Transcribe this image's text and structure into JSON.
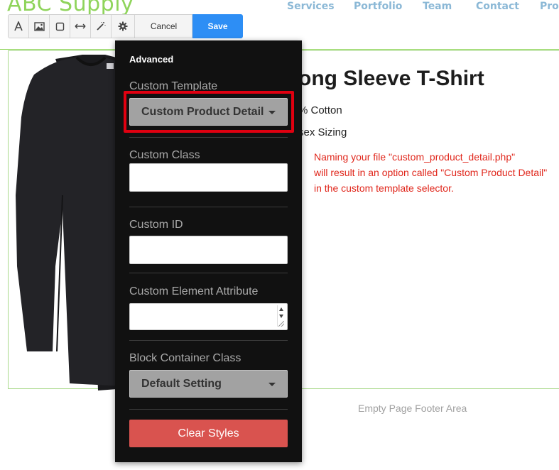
{
  "site": {
    "logo": "ABC Supply",
    "nav": [
      "Services",
      "Portfolio",
      "Team",
      "Contact",
      "Prod"
    ]
  },
  "toolbar": {
    "icons": [
      "text-icon",
      "image-icon",
      "border-icon",
      "spacing-icon",
      "magic-wand-icon",
      "gear-icon"
    ],
    "cancel_label": "Cancel",
    "save_label": "Save",
    "save_color": "#2d8ef5"
  },
  "product": {
    "title": "ong Sleeve T-Shirt",
    "features": [
      "% Cotton",
      "sex Sizing"
    ],
    "note_lines": [
      "Naming your file \"custom_product_detail.php\"",
      "will result in an option called \"Custom Product Detail\"",
      "in the custom template selector."
    ],
    "note_color": "#e0261b"
  },
  "footer": {
    "text": "Empty Page Footer Area"
  },
  "panel": {
    "heading": "Advanced",
    "custom_template": {
      "label": "Custom Template",
      "value": "Custom Product Detail"
    },
    "custom_class": {
      "label": "Custom Class",
      "value": ""
    },
    "custom_id": {
      "label": "Custom ID",
      "value": ""
    },
    "custom_element_attribute": {
      "label": "Custom Element Attribute",
      "value": ""
    },
    "block_container_class": {
      "label": "Block Container Class",
      "value": "Default Setting"
    },
    "clear_label": "Clear Styles",
    "clear_color": "#d9534f",
    "highlight_color": "#e00010"
  }
}
